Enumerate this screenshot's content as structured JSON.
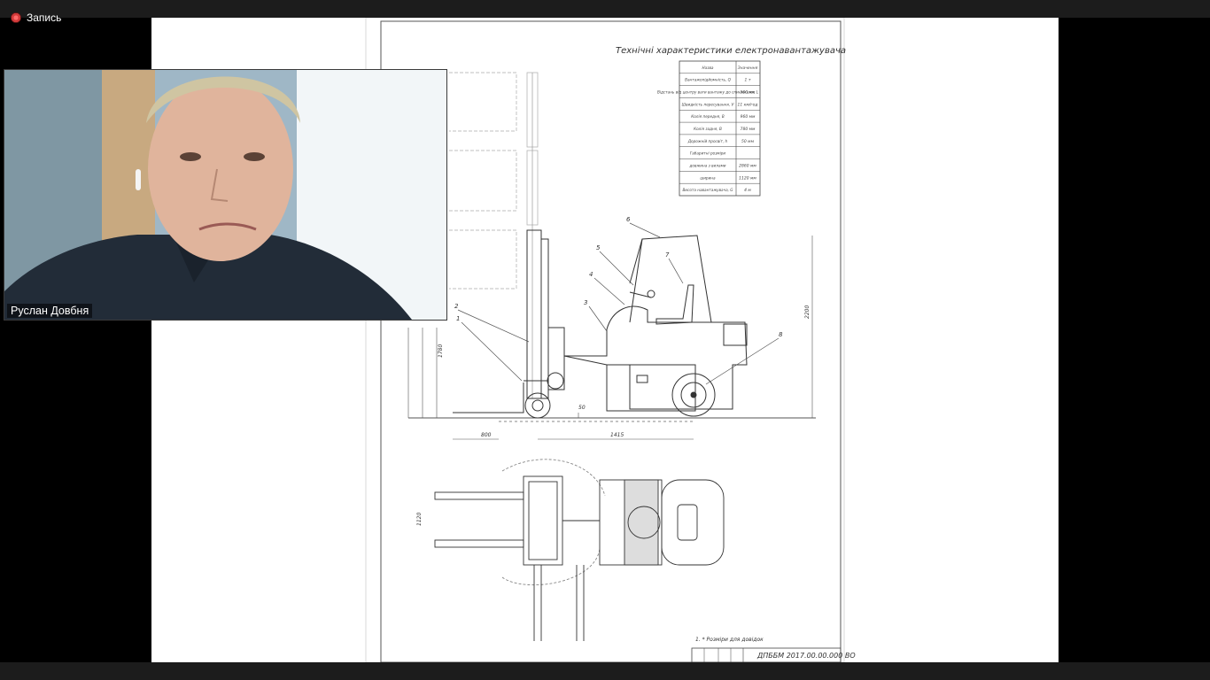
{
  "recording": {
    "label": "Запись",
    "icon": "record-dot-icon",
    "color": "#d23a3a"
  },
  "participant": {
    "name": "Руслан Довбня"
  },
  "drawing": {
    "title": "Технічні характеристики електронавантажувача",
    "table_header": [
      "Назва",
      "Значення"
    ],
    "table_rows": [
      [
        "Вантажопідйомність, Q",
        "1 т"
      ],
      [
        "Відстань від центру ваги вантажу до спинки вил, L",
        "500 мм"
      ],
      [
        "Швидкість пересування, V",
        "11 км/год"
      ],
      [
        "Колія передня, B",
        "960 мм"
      ],
      [
        "Колія задня, B",
        "780 мм"
      ],
      [
        "Дорожній просвіт, h",
        "50 мм"
      ],
      [
        "Габаритні розміри",
        ""
      ],
      [
        "довжина з вилами",
        "2860 мм"
      ],
      [
        "ширина",
        "1120 мм"
      ],
      [
        "Висота навантажувача, G",
        "4 м"
      ]
    ],
    "leader_numbers": [
      "1",
      "2",
      "3",
      "4",
      "5",
      "6",
      "7",
      "8"
    ],
    "dimensions": {
      "fork_len": "800",
      "wheelbase": "1415",
      "height_right": "2200",
      "mast_height": "1780",
      "clearance": "50",
      "width_plan": "1120"
    },
    "footnote": "1. * Розміри для довідок",
    "stamp_code": "ДПББМ 2017.00.00.000 ВО"
  }
}
